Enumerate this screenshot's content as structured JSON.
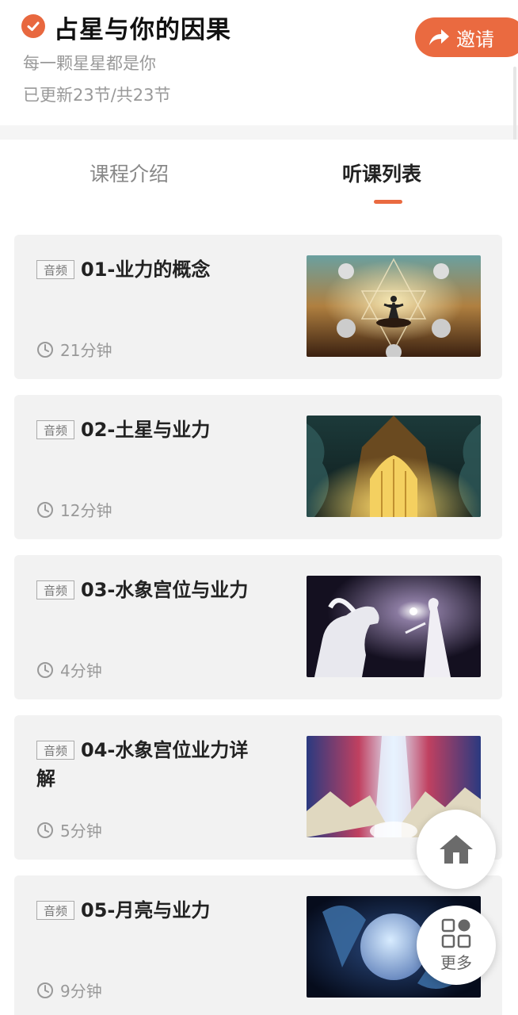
{
  "header": {
    "title": "占星与你的因果",
    "subtitle": "每一颗星星都是你",
    "update_info": "已更新23节/共23节",
    "invite_label": "邀请"
  },
  "tabs": [
    {
      "label": "课程介绍",
      "active": false
    },
    {
      "label": "听课列表",
      "active": true
    }
  ],
  "lessons": [
    {
      "tag": "音频",
      "title": "01-业力的概念",
      "duration": "21分钟",
      "thumbnail": "figure-star-orbs"
    },
    {
      "tag": "音频",
      "title": "02-土星与业力",
      "duration": "12分钟",
      "thumbnail": "golden-cathedral"
    },
    {
      "tag": "音频",
      "title": "03-水象宫位与业力",
      "duration": "4分钟",
      "thumbnail": "unicorn-and-woman"
    },
    {
      "tag": "音频",
      "title": "04-水象宫位业力详解",
      "duration": "5分钟",
      "thumbnail": "light-over-mountains"
    },
    {
      "tag": "音频",
      "title": "05-月亮与业力",
      "duration": "9分钟",
      "thumbnail": "moon-and-dolphins"
    }
  ],
  "fab": {
    "home_icon": "home-icon",
    "more_label": "更多"
  },
  "colors": {
    "accent": "#ea6a40",
    "muted_text": "#999999",
    "card_bg": "#f2f2f2"
  }
}
